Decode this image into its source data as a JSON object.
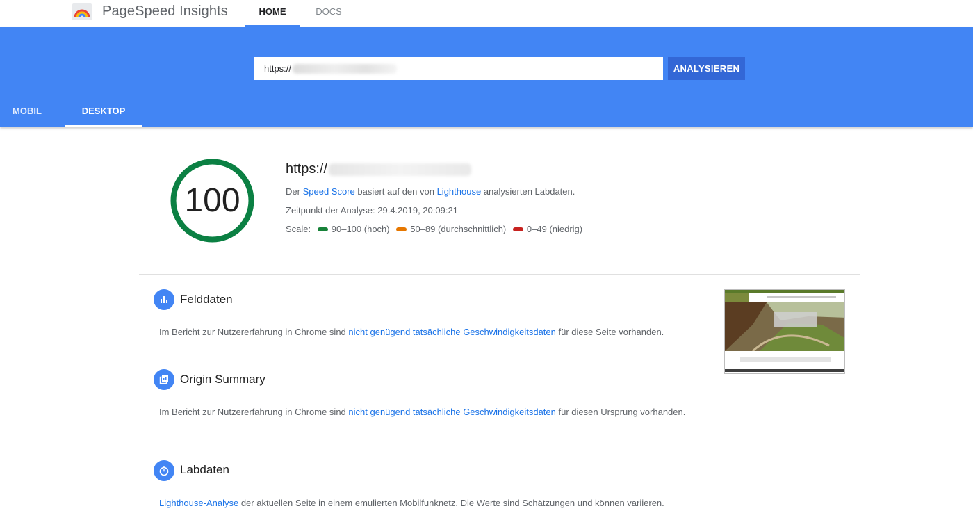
{
  "header": {
    "app_title": "PageSpeed Insights",
    "nav": [
      {
        "label": "HOME"
      },
      {
        "label": "DOCS"
      }
    ]
  },
  "search": {
    "url_prefix": "https://",
    "button_label": "ANALYSIEREN"
  },
  "device_tabs": [
    {
      "label": "MOBIL"
    },
    {
      "label": "DESKTOP"
    }
  ],
  "summary": {
    "score": "100",
    "score_fraction": 1.0,
    "score_color": "#0b8043",
    "url_prefix": "https://",
    "speed_line": {
      "pre": "Der",
      "link1": "Speed Score",
      "mid": "basiert auf den von",
      "link2": "Lighthouse",
      "post": "analysierten Labdaten."
    },
    "timestamp_line": "Zeitpunkt der Analyse: 29.4.2019, 20:09:21",
    "scale": {
      "label": "Scale:",
      "items": [
        {
          "text": "90–100 (hoch)",
          "color": "#178239"
        },
        {
          "text": "50–89 (durchschnittlich)",
          "color": "#e67700"
        },
        {
          "text": "0–49 (niedrig)",
          "color": "#c7221f"
        }
      ]
    }
  },
  "sections": {
    "field": {
      "icon": "bar-chart-icon",
      "title": "Felddaten",
      "text_pre": "Im Bericht zur Nutzererfahrung in Chrome sind",
      "text_link": "nicht genügend tatsächliche Geschwindigkeitsdaten",
      "text_post": "für diese Seite vorhanden."
    },
    "origin": {
      "icon": "origin-summary-icon",
      "title": "Origin Summary",
      "text_pre": "Im Bericht zur Nutzererfahrung in Chrome sind",
      "text_link": "nicht genügend tatsächliche Geschwindigkeitsdaten",
      "text_post": "für diesen Ursprung vorhanden."
    },
    "lab": {
      "icon": "stopwatch-icon",
      "title": "Labdaten",
      "text_link": "Lighthouse-Analyse",
      "text_post": "der aktuellen Seite in einem emulierten Mobilfunknetz. Die Werte sind Schätzungen und können variieren."
    }
  },
  "colors": {
    "brand_blue": "#4285f4",
    "button_blue": "#3367d6",
    "link_blue": "#1a73e8"
  }
}
